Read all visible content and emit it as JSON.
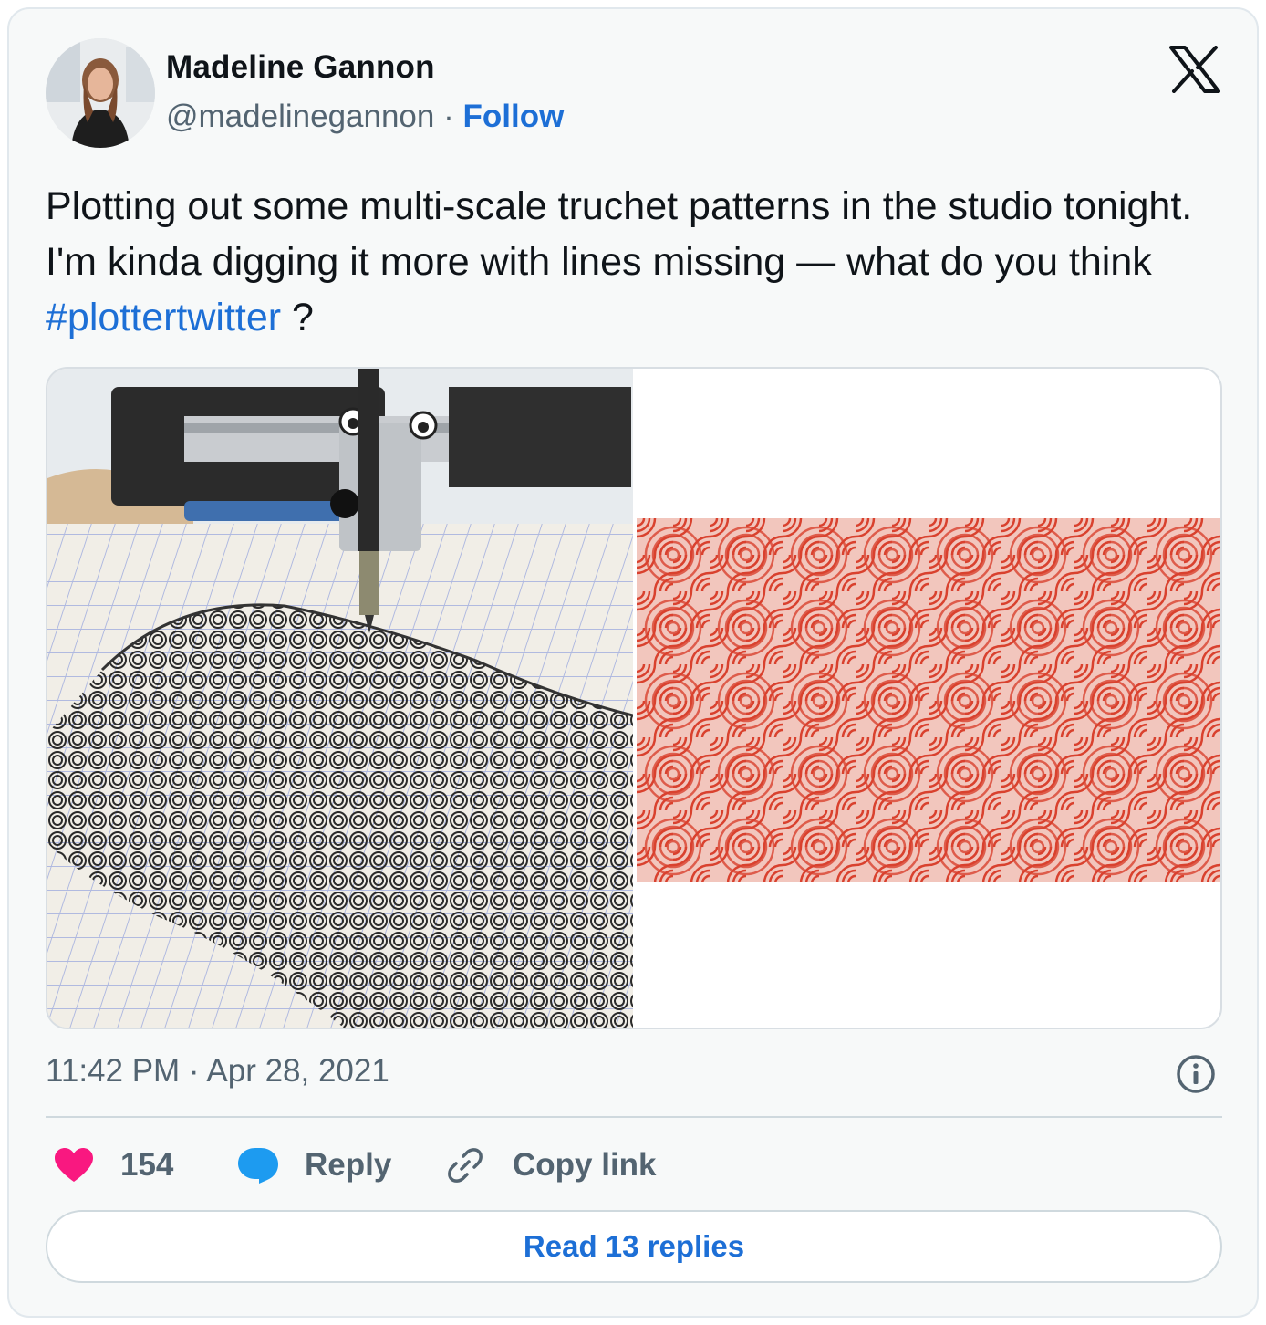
{
  "author": {
    "name": "Madeline Gannon",
    "handle": "@madelinegannon",
    "separator": "·",
    "follow_label": "Follow"
  },
  "tweet": {
    "text_before": "Plotting out some multi-scale truchet patterns in the studio tonight. I'm kinda digging it more with lines missing — what do you think ",
    "hashtag": "#plottertwitter",
    "text_after": " ?"
  },
  "media": {
    "left_icon": "pen-plotter-photo",
    "right_icon": "red-truchet-pattern-image"
  },
  "meta": {
    "timestamp": "11:42 PM · Apr 28, 2021"
  },
  "actions": {
    "like_count": "154",
    "reply_label": "Reply",
    "copy_label": "Copy link"
  },
  "footer": {
    "read_replies_label": "Read 13 replies"
  },
  "colors": {
    "link": "#1d6fd6",
    "heart": "#f91880",
    "reply_bubble": "#1d9bf0",
    "pattern_red": "#d9412e",
    "card_bg": "#f7f9f9"
  }
}
